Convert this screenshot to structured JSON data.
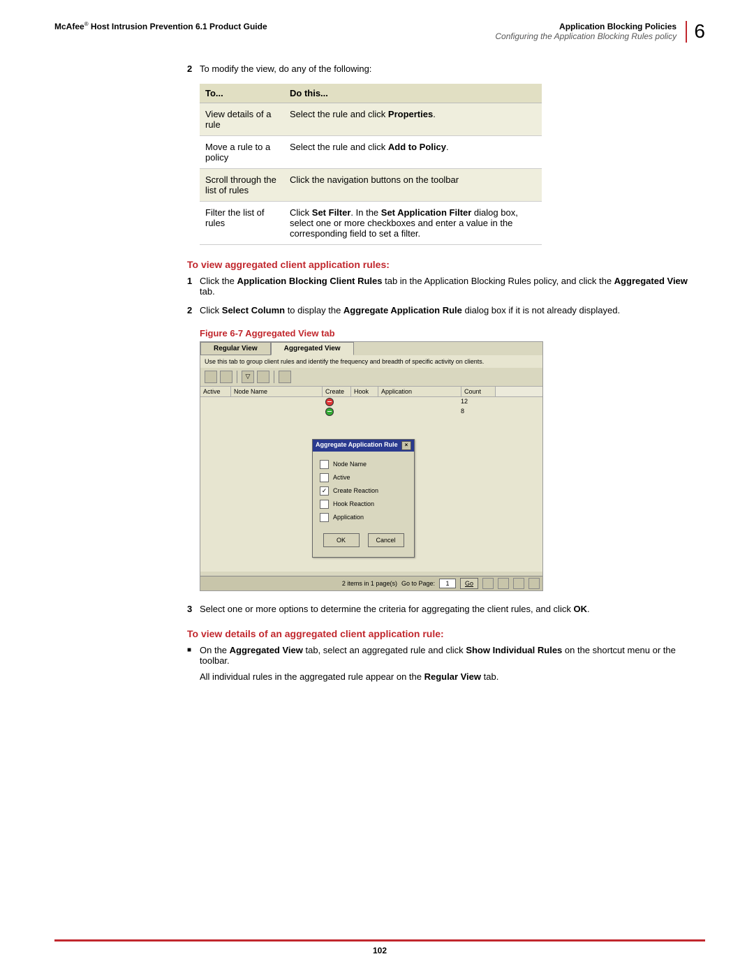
{
  "header": {
    "brand": "McAfee",
    "reg": "®",
    "guide": " Host Intrusion Prevention 6.1 Product Guide",
    "topic": "Application Blocking Policies",
    "sub": "Configuring the Application Blocking Rules policy",
    "chapter": "6"
  },
  "intro_step": {
    "num": "2",
    "text": "To modify the view, do any of the following:"
  },
  "table": {
    "h1": "To...",
    "h2": "Do this...",
    "rows": [
      {
        "c1": "View details of a rule",
        "c2_pre": "Select the rule and click ",
        "c2_bold": "Properties",
        "c2_post": "."
      },
      {
        "c1": "Move a rule to a policy",
        "c2_pre": "Select the rule and click ",
        "c2_bold": "Add to Policy",
        "c2_post": "."
      },
      {
        "c1": "Scroll through the list of rules",
        "c2_pre": "Click the navigation buttons on the toolbar",
        "c2_bold": "",
        "c2_post": ""
      },
      {
        "c1": "Filter the list of rules",
        "c2_pre": "Click ",
        "c2_bold": "Set Filter",
        "c2_post": ". In the ",
        "c2_bold2": "Set Application Filter",
        "c2_post2": " dialog box, select one or more checkboxes and enter a value in the corresponding field to set a filter."
      }
    ]
  },
  "section1": {
    "heading": "To view aggregated client application rules:",
    "step1": {
      "num": "1",
      "pre": "Click the ",
      "b1": "Application Blocking Client Rules",
      "mid": " tab in the Application Blocking Rules policy, and click the ",
      "b2": "Aggregated View",
      "post": " tab."
    },
    "step2": {
      "num": "2",
      "pre": "Click ",
      "b1": "Select Column",
      "mid": " to display the ",
      "b2": "Aggregate Application Rule",
      "post": " dialog box if it is not already displayed."
    },
    "fig_caption": "Figure 6-7  Aggregated View tab"
  },
  "screenshot": {
    "tabs": {
      "regular": "Regular View",
      "aggregated": "Aggregated View"
    },
    "instr": "Use this tab to group client rules and identify the frequency and breadth of specific activity on clients.",
    "cols": {
      "active": "Active",
      "node": "Node Name",
      "create": "Create",
      "hook": "Hook",
      "app": "Application",
      "count": "Count"
    },
    "counts": [
      "12",
      "8"
    ],
    "dialog": {
      "title": "Aggregate Application Rule",
      "opts": {
        "node": "Node Name",
        "active": "Active",
        "create": "Create Reaction",
        "hook": "Hook Reaction",
        "app": "Application"
      },
      "ok": "OK",
      "cancel": "Cancel"
    },
    "status": {
      "items": "2 items in 1 page(s)",
      "goto": "Go to Page:",
      "page": "1",
      "go": "Go"
    }
  },
  "step3": {
    "num": "3",
    "pre": "Select one or more options to determine the criteria for aggregating the client rules, and click ",
    "b1": "OK",
    "post": "."
  },
  "section2": {
    "heading": "To view details of an aggregated client application rule:",
    "bullet": {
      "pre": "On the ",
      "b1": "Aggregated View",
      "mid1": " tab, select an aggregated rule and click ",
      "b2": "Show Individual Rules",
      "mid2": " on the shortcut menu or the toolbar."
    },
    "para": {
      "pre": "All individual rules in the aggregated rule appear on the ",
      "b1": "Regular View",
      "post": " tab."
    }
  },
  "footer": {
    "page": "102"
  }
}
